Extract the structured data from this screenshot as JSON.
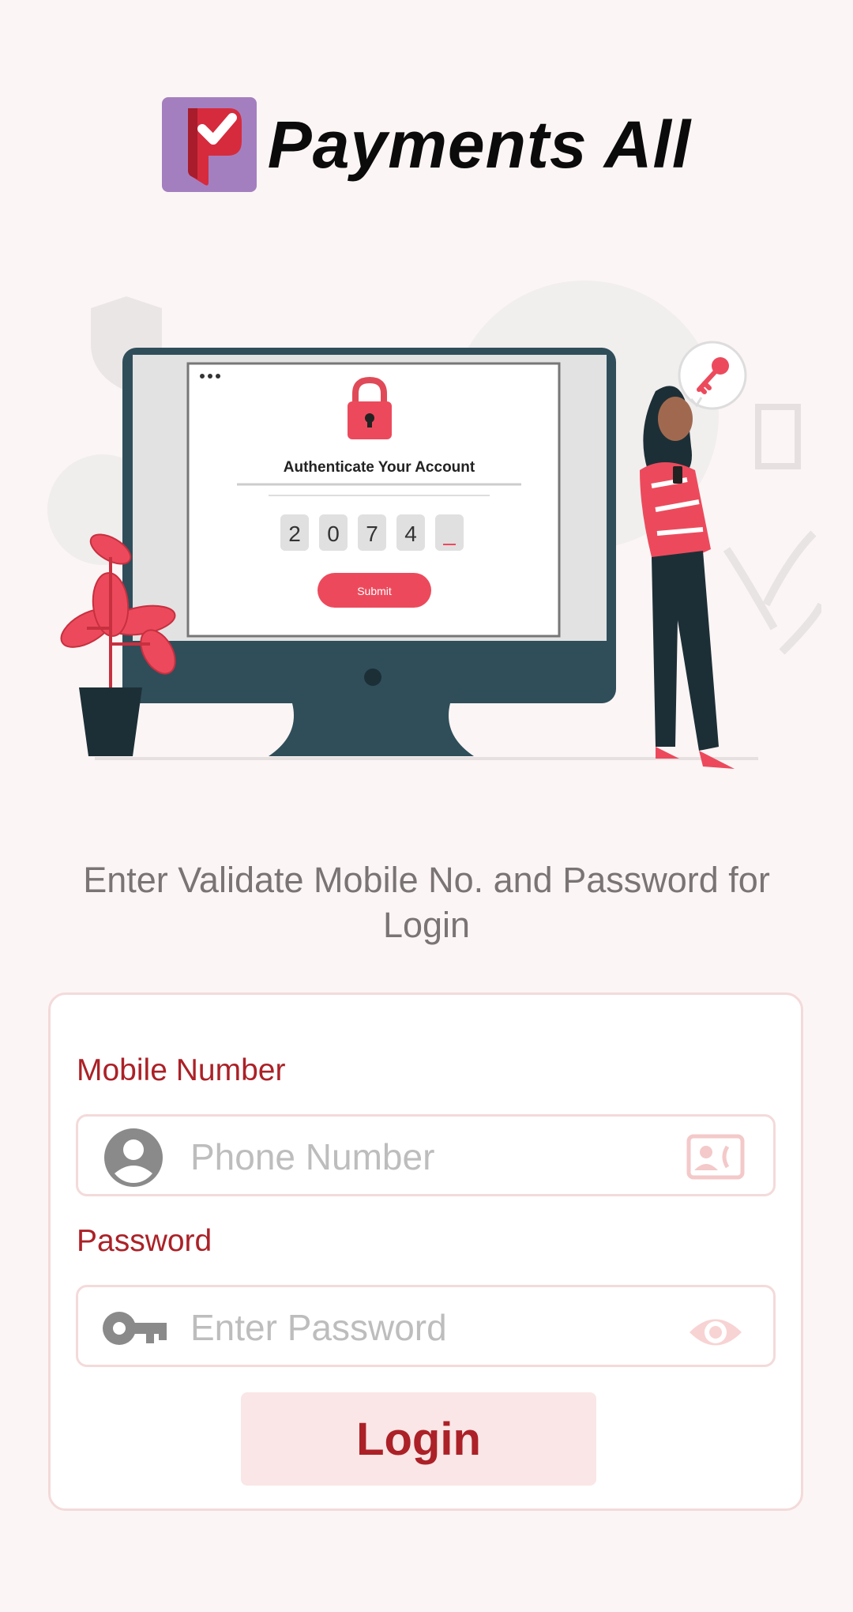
{
  "app": {
    "title": "Payments All"
  },
  "illustration": {
    "screen_heading": "Authenticate Your Account",
    "otp_digits": [
      "2",
      "0",
      "7",
      "4",
      ""
    ],
    "submit_label": "Submit"
  },
  "instruction": "Enter Validate Mobile No. and Password for Login",
  "form": {
    "mobile": {
      "label": "Mobile Number",
      "placeholder": "Phone Number",
      "value": ""
    },
    "password": {
      "label": "Password",
      "placeholder": "Enter Password",
      "value": ""
    },
    "login_label": "Login"
  },
  "colors": {
    "accent": "#ab2127",
    "background": "#fcf5f5",
    "logo_bg": "#a47fbf",
    "illustration_red": "#ec4a5c",
    "button_bg": "#fae6e6"
  }
}
